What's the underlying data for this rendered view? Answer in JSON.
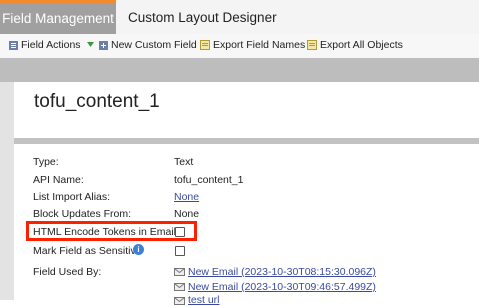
{
  "tabs": [
    {
      "label": "Field Management"
    },
    {
      "label": "Custom Layout Designer"
    }
  ],
  "toolbar": {
    "field_actions": "Field Actions",
    "new_custom_field": "New Custom Field",
    "export_field_names": "Export Field Names",
    "export_all_objects": "Export All Objects"
  },
  "field": {
    "name": "tofu_content_1",
    "rows": [
      {
        "label": "Type:",
        "value": "Text"
      },
      {
        "label": "API Name:",
        "value": "tofu_content_1"
      },
      {
        "label": "List Import Alias:",
        "value": "None"
      },
      {
        "label": "Block Updates From:",
        "value": "None"
      },
      {
        "label": "HTML Encode Tokens in Emails:",
        "checked": false
      },
      {
        "label": "Mark Field as Sensitive",
        "checked": false
      },
      {
        "label": "Field Used By:"
      }
    ],
    "used_by": [
      "New Email (2023-10-30T08:15:30.096Z)",
      "New Email (2023-10-30T09:46:57.499Z)",
      "test url"
    ]
  },
  "colors": {
    "active_tab_accent": "#f28a2e",
    "highlight_border": "#ff2000",
    "link": "#3b4aa0"
  }
}
